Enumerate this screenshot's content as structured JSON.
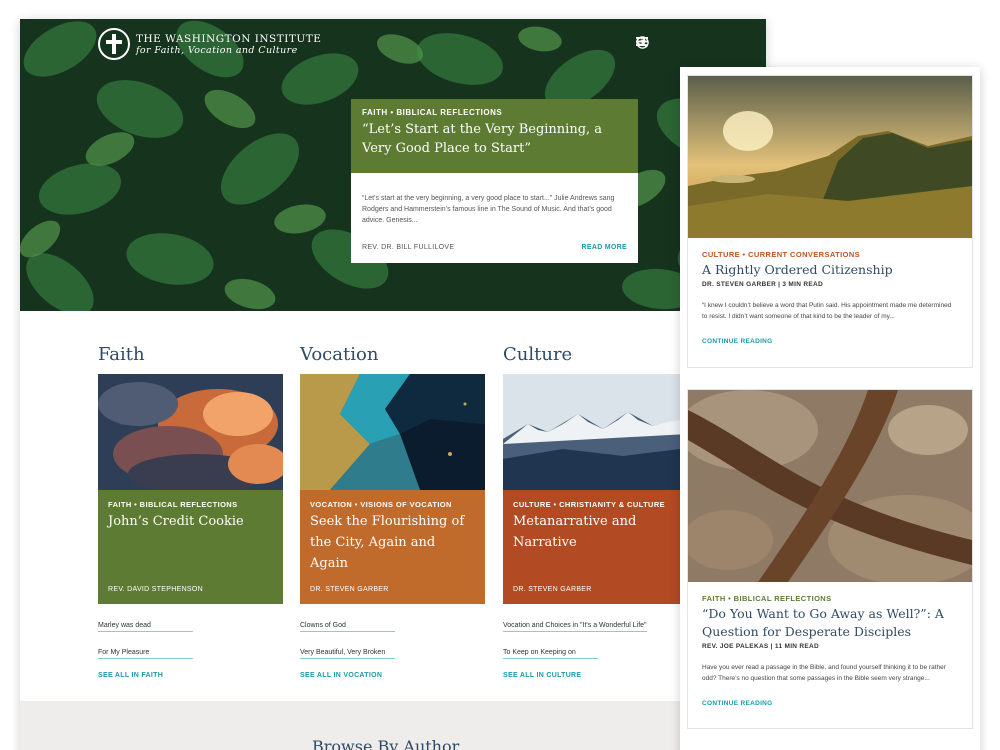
{
  "colors": {
    "faith": "#5e7b33",
    "vocation": "#c06a2c",
    "culture": "#b24a23",
    "teal": "#1b9aa6",
    "navy": "#2f4a66",
    "culture_kicker": "#c0541e",
    "faith_kicker": "#5e7b33"
  },
  "header": {
    "logo_line1": "THE WASHINGTON INSTITUTE",
    "logo_line2": "for Faith, Vocation and Culture",
    "icons": [
      "search-icon",
      "help-icon",
      "menu-icon"
    ]
  },
  "featured": {
    "kicker": "FAITH • BIBLICAL REFLECTIONS",
    "title": "“Let’s Start at the Very Beginning, a Very Good Place to Start”",
    "excerpt": "“Let’s start at the very beginning, a very good place to start...” Julie Andrews sang Rodgers and Hammerstein’s famous line in The Sound of Music.  And that’s good advice. Genesis...",
    "author": "REV. DR. BILL FULLILOVE",
    "read_more": "READ MORE"
  },
  "columns": [
    {
      "heading": "Faith",
      "kicker": "FAITH • BIBLICAL REFLECTIONS",
      "title": "John’s Credit Cookie",
      "author": "REV. DAVID STEPHENSON",
      "links": [
        "Marley was dead",
        "For My Pleasure"
      ],
      "see_all": "SEE ALL IN FAITH"
    },
    {
      "heading": "Vocation",
      "kicker": "VOCATION • VISIONS OF VOCATION",
      "title": "Seek the Flourishing of the City, Again and Again",
      "author": "DR. STEVEN GARBER",
      "links": [
        "Clowns of God",
        "Very Beautiful, Very Broken"
      ],
      "see_all": "SEE ALL IN VOCATION"
    },
    {
      "heading": "Culture",
      "kicker": "CULTURE • CHRISTIANITY & CULTURE",
      "title": "Metanarrative and Narrative",
      "author": "DR. STEVEN GARBER",
      "links": [
        "Vocation and Choices in \"It's a Wonderful Life\"",
        "To Keep on Keeping on"
      ],
      "see_all": "SEE ALL IN CULTURE"
    }
  ],
  "browse": {
    "title": "Browse By Author"
  },
  "mobile": {
    "cards": [
      {
        "kicker": "CULTURE • CURRENT CONVERSATIONS",
        "title": "A Rightly Ordered Citizenship",
        "meta": "DR. STEVEN GARBER | 3 MIN READ",
        "excerpt": "“I knew I couldn’t believe a word that Putin said. His appointment made me determined to resist. I didn’t want someone of that kind to be the leader of my...",
        "cta": "CONTINUE READING"
      },
      {
        "kicker": "FAITH • BIBLICAL REFLECTIONS",
        "title": "“Do You Want to Go Away as Well?”: A Question for Desperate Disciples",
        "meta": "REV. JOE PALEKAS | 11 MIN READ",
        "excerpt": "Have you ever read a passage in the Bible, and found yourself thinking it to be rather odd? There’s no question that some passages in the Bible seem very strange...",
        "cta": "CONTINUE READING"
      }
    ]
  }
}
